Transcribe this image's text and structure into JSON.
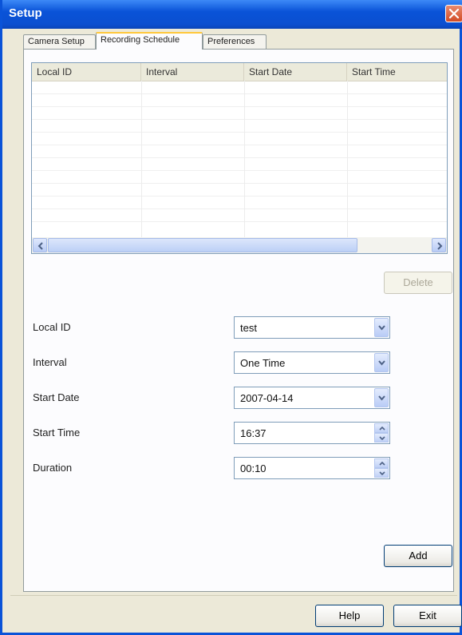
{
  "window": {
    "title": "Setup"
  },
  "tabs": [
    {
      "label": "Camera Setup"
    },
    {
      "label": "Recording Schedule"
    },
    {
      "label": "Preferences"
    }
  ],
  "grid": {
    "columns": [
      "Local ID",
      "Interval",
      "Start Date",
      "Start Time"
    ],
    "rows": []
  },
  "buttons": {
    "delete": "Delete",
    "add": "Add",
    "help": "Help",
    "exit": "Exit"
  },
  "form": {
    "local_id": {
      "label": "Local ID",
      "value": "test"
    },
    "interval": {
      "label": "Interval",
      "value": "One Time"
    },
    "start_date": {
      "label": "Start Date",
      "value": "2007-04-14"
    },
    "start_time": {
      "label": "Start Time",
      "value": "16:37"
    },
    "duration": {
      "label": "Duration",
      "value": "00:10"
    }
  },
  "colors": {
    "title_bar": "#0a53d8",
    "active_tab_accent": "#ffc83c",
    "dialog_bg": "#ece9d8"
  },
  "icons": {
    "close": "close-icon",
    "dropdown": "chevron-down-icon",
    "spinner": "spinner-icon",
    "scroll_left": "arrow-left-icon",
    "scroll_right": "arrow-right-icon"
  }
}
